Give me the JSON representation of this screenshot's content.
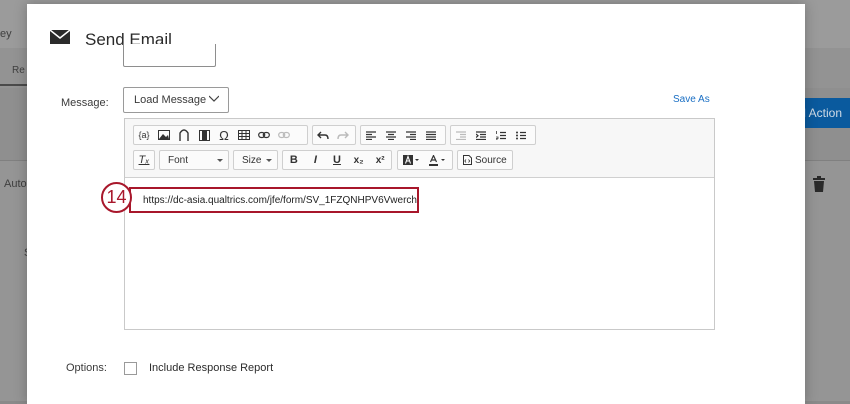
{
  "background": {
    "partial_label_top": "ey",
    "partial_tab": "Re",
    "partial_auto": "Auto",
    "partial_char": "S",
    "action_button_label": "d Action",
    "accent_color": "#0a5a9e"
  },
  "modal": {
    "title": "Send Email",
    "title_icon": "envelope-icon",
    "message_label": "Message:",
    "load_message_label": "Load Message",
    "save_as_label": "Save As",
    "link_color": "#1a6fc4",
    "highlight_color": "#a8172b",
    "step_number": "14",
    "body_url": "https://dc-asia.qualtrics.com/jfe/form/SV_1FZQNHPV6Vwerch",
    "options_label": "Options:",
    "include_response_report_label": "Include Response Report",
    "include_response_report_checked": false
  },
  "toolbar": {
    "row1_icons": [
      "piped-text-icon",
      "image-icon",
      "horseshoe-icon",
      "film-icon",
      "omega-icon",
      "table-icon",
      "link-icon",
      "unlink-icon",
      "undo-icon",
      "redo-icon",
      "align-left-icon",
      "align-center-icon",
      "align-right-icon",
      "align-justify-icon",
      "outdent-icon",
      "indent-icon",
      "numbered-list-icon",
      "bulleted-list-icon"
    ],
    "piped_text_glyph": "{a}",
    "omega_glyph": "Ω",
    "clear_format_glyph": "Tₓ",
    "font_label": "Font",
    "size_label": "Size",
    "bold_glyph": "B",
    "italic_glyph": "I",
    "underline_glyph": "U",
    "subscript_glyph": "x₂",
    "superscript_glyph": "x²",
    "source_label": "Source"
  }
}
